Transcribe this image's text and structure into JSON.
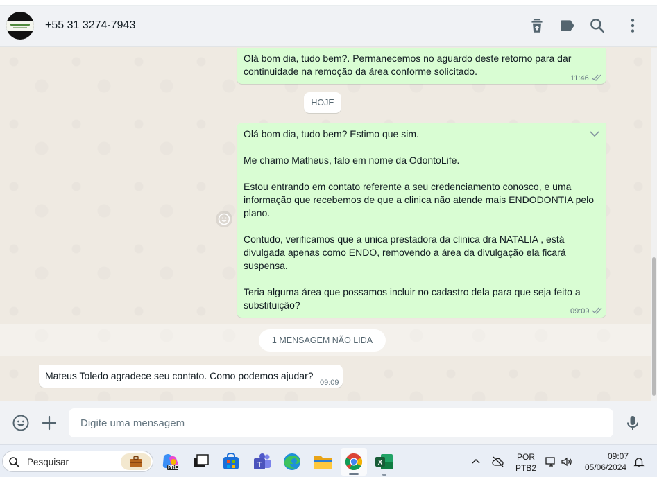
{
  "header": {
    "contact_name": "+55 31 3274-7943",
    "icons": [
      "delete-icon",
      "label-icon",
      "search-icon",
      "menu-icon"
    ]
  },
  "messages": {
    "first": {
      "text": "Olá bom dia, tudo bem?. Permanecemos no aguardo deste retorno para dar\ncontinuidade na remoção da área conforme solicitado.",
      "time": "11:46"
    },
    "date_pill": "HOJE",
    "second": {
      "text": "Olá bom dia, tudo bem? Estimo que sim.\n\nMe chamo Matheus, falo em nome da OdontoLife.\n\nEstou entrando em contato referente a seu credenciamento conosco, e uma\ninformação que recebemos de que a clinica não atende mais ENDODONTIA pelo\nplano.\n\nContudo, verificamos que a unica prestadora da clinica dra NATALIA , está\ndivulgada apenas como ENDO, removendo a área da divulgação ela ficará\nsuspensa.\n\nTeria alguma área que possamos incluir no cadastro dela para que seja feito a\nsubstituição?",
      "time": "09:09"
    },
    "unread_label": "1 MENSAGEM NÃO LIDA",
    "incoming": {
      "text": "Mateus Toledo agradece seu contato. Como podemos ajudar?",
      "time": "09:09"
    }
  },
  "composer": {
    "placeholder": "Digite uma mensagem"
  },
  "taskbar": {
    "search_label": "Pesquisar",
    "apps": [
      "briefcase-icon",
      "copilot-icon",
      "task-view-icon",
      "store-icon",
      "teams-icon",
      "edge-icon",
      "file-explorer-icon",
      "chrome-icon",
      "excel-icon"
    ],
    "lang_top": "POR",
    "lang_bottom": "PTB2",
    "time": "09:07",
    "date": "05/06/2024",
    "copilot_badge": "PRE"
  },
  "colors": {
    "outgoing_bubble": "#d9fdd3",
    "incoming_bubble": "#ffffff",
    "chat_background": "#efeae2",
    "header_background": "#f0f2f5"
  }
}
